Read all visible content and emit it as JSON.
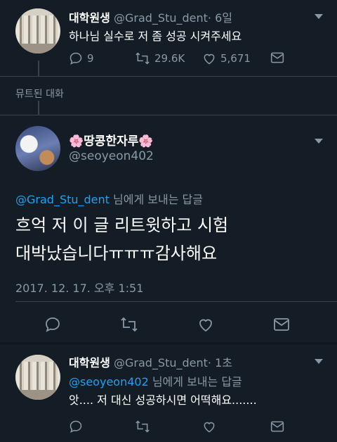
{
  "tweet1": {
    "display_name": "대학원생",
    "handle": "@Grad_Stu_dent",
    "time": "· 6일",
    "text": "하나님 실수로 저 좀 성공 시켜주세요",
    "reply_count": "9",
    "retweet_count": "29.6K",
    "like_count": "5,671"
  },
  "muted": {
    "label": "뮤트된 대화"
  },
  "tweet2": {
    "display_name": "🌸땅콩한자루🌸",
    "handle": "@seoyeon402",
    "reply_to_handle": "@Grad_Stu_dent",
    "reply_to_suffix": " 님에게 보내는 답글",
    "text_line1": "흐억 저 이 글 리트윗하고 시험",
    "text_line2": "대박났습니다ㅠㅠㅠ감사해요",
    "timestamp": "2017. 12. 17. 오후 1:51"
  },
  "tweet3": {
    "display_name": "대학원생",
    "handle": "@Grad_Stu_dent",
    "time": "· 1초",
    "reply_to_handle": "@seoyeon402",
    "reply_to_suffix": " 님에게 보내는 답글",
    "text": "앗.... 저 대신 성공하시면 어떡해요......."
  },
  "icons": [
    "reply-icon",
    "retweet-icon",
    "like-icon",
    "message-icon",
    "chevron-down-icon"
  ],
  "colors": {
    "background": "#141d26",
    "link": "#1da1f2",
    "muted": "#8899a6",
    "divider": "#38444d"
  }
}
